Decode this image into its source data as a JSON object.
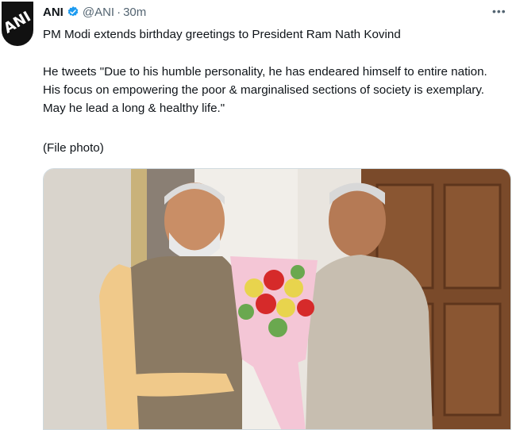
{
  "tweet": {
    "author_name": "ANI",
    "handle": "@ANI",
    "separator": "·",
    "time": "30m",
    "more": "•••",
    "avatar_text": "ANI",
    "line1": "PM Modi extends birthday greetings to President Ram Nath Kovind",
    "quote": "He tweets \"Due to his humble personality, he has endeared himself to entire nation. His focus on empowering the poor & marginalised sections of society is exemplary. May he lead a long & healthy life.\"",
    "file_note": "(File photo)"
  },
  "colors": {
    "verified": "#1d9bf0",
    "muted": "#536471",
    "text": "#0f1419"
  }
}
